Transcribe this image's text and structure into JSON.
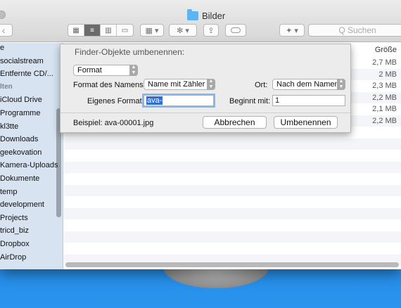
{
  "window": {
    "title": "Bilder"
  },
  "toolbar": {
    "back": "‹",
    "view_modes": [
      "▦",
      "≡",
      "▥",
      "▭"
    ],
    "arrange": "▦ ▾",
    "action": "✻ ▾",
    "share": "⇪",
    "dropbox": "✦ ▾",
    "search_placeholder": "Q Suchen"
  },
  "sidebar": {
    "items": [
      {
        "label": "e",
        "head": false
      },
      {
        "label": "socialstream",
        "head": false
      },
      {
        "label": "Entfernte CD/...",
        "head": false
      },
      {
        "label": "lten",
        "head": true
      },
      {
        "label": "iCloud Drive",
        "head": false
      },
      {
        "label": "Programme",
        "head": false
      },
      {
        "label": "kl3tte",
        "head": false
      },
      {
        "label": "Downloads",
        "head": false
      },
      {
        "label": "geekovation",
        "head": false
      },
      {
        "label": "Kamera-Uploads",
        "head": false
      },
      {
        "label": "Dokumente",
        "head": false
      },
      {
        "label": "temp",
        "head": false
      },
      {
        "label": "development",
        "head": false
      },
      {
        "label": "Projects",
        "head": false
      },
      {
        "label": "tricd_biz",
        "head": false
      },
      {
        "label": "Dropbox",
        "head": false
      },
      {
        "label": "AirDrop",
        "head": false
      }
    ]
  },
  "list": {
    "column_size": "Größe",
    "sizes": [
      "2,7 MB",
      "2 MB",
      "2,3 MB",
      "2,2 MB",
      "2,1 MB",
      "2,2 MB"
    ]
  },
  "dialog": {
    "title": "Finder-Objekte umbenennen:",
    "mode": "Format",
    "name_format_label": "Format des Namens:",
    "name_format_value": "Name mit Zähler",
    "where_label": "Ort:",
    "where_value": "Nach dem Namen",
    "custom_format_label": "Eigenes Format:",
    "custom_format_value": "ava-",
    "start_at_label": "Beginnt mit:",
    "start_at_value": "1",
    "example": "Beispiel: ava-00001.jpg",
    "cancel": "Abbrechen",
    "rename": "Umbenennen"
  },
  "colors": {
    "selection": "#2e6fd6",
    "sidebar": "#d7e3f1",
    "desktop": "#1a79d6"
  }
}
